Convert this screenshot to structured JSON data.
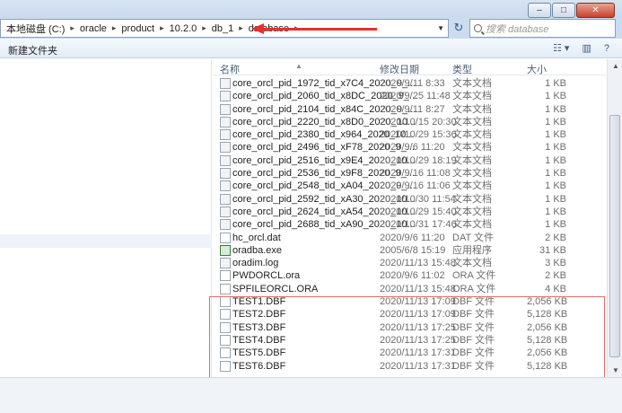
{
  "window": {
    "min_label": "–",
    "max_label": "□",
    "close_label": "✕"
  },
  "address": {
    "crumbs": [
      "本地磁盘 (C:)",
      "oracle",
      "product",
      "10.2.0",
      "db_1",
      "database"
    ],
    "separator": "▸"
  },
  "search": {
    "placeholder": "搜索 database"
  },
  "toolbar": {
    "new_folder_label": "新建文件夹"
  },
  "columns": {
    "name": "名称",
    "date": "修改日期",
    "type": "类型",
    "size": "大小"
  },
  "files": [
    {
      "name": "core_orcl_pid_1972_tid_x7C4_2020_9_...",
      "date": "2020/9/11 8:33",
      "type": "文本文档",
      "size": "1 KB",
      "icon": "text-file"
    },
    {
      "name": "core_orcl_pid_2060_tid_x8DC_2020_9_...",
      "date": "2020/9/25 11:48",
      "type": "文本文档",
      "size": "1 KB",
      "icon": "text-file"
    },
    {
      "name": "core_orcl_pid_2104_tid_x84C_2020_9_...",
      "date": "2020/9/11 8:27",
      "type": "文本文档",
      "size": "1 KB",
      "icon": "text-file"
    },
    {
      "name": "core_orcl_pid_2220_tid_x8D0_2020_10...",
      "date": "2020/10/15 20:30",
      "type": "文本文档",
      "size": "1 KB",
      "icon": "text-file"
    },
    {
      "name": "core_orcl_pid_2380_tid_x964_2020_10...",
      "date": "2020/10/29 15:36",
      "type": "文本文档",
      "size": "1 KB",
      "icon": "text-file"
    },
    {
      "name": "core_orcl_pid_2496_tid_xF78_2020_9_...",
      "date": "2020/9/6 11:20",
      "type": "文本文档",
      "size": "1 KB",
      "icon": "text-file"
    },
    {
      "name": "core_orcl_pid_2516_tid_x9E4_2020_10...",
      "date": "2020/10/29 18:19",
      "type": "文本文档",
      "size": "1 KB",
      "icon": "text-file"
    },
    {
      "name": "core_orcl_pid_2536_tid_x9F8_2020_9_...",
      "date": "2020/9/16 11:08",
      "type": "文本文档",
      "size": "1 KB",
      "icon": "text-file"
    },
    {
      "name": "core_orcl_pid_2548_tid_xA04_2020_9_...",
      "date": "2020/9/16 11:06",
      "type": "文本文档",
      "size": "1 KB",
      "icon": "text-file"
    },
    {
      "name": "core_orcl_pid_2592_tid_xA30_2020_10...",
      "date": "2020/10/30 11:54",
      "type": "文本文档",
      "size": "1 KB",
      "icon": "text-file"
    },
    {
      "name": "core_orcl_pid_2624_tid_xA54_2020_10...",
      "date": "2020/10/29 15:40",
      "type": "文本文档",
      "size": "1 KB",
      "icon": "text-file"
    },
    {
      "name": "core_orcl_pid_2688_tid_xA90_2020_10...",
      "date": "2020/10/31 17:46",
      "type": "文本文档",
      "size": "1 KB",
      "icon": "text-file"
    },
    {
      "name": "hc_orcl.dat",
      "date": "2020/9/6 11:20",
      "type": "DAT 文件",
      "size": "2 KB",
      "icon": "file"
    },
    {
      "name": "oradba.exe",
      "date": "2005/6/8 15:19",
      "type": "应用程序",
      "size": "31 KB",
      "icon": "exe"
    },
    {
      "name": "oradim.log",
      "date": "2020/11/13 15:48",
      "type": "文本文档",
      "size": "3 KB",
      "icon": "text-file"
    },
    {
      "name": "PWDORCL.ora",
      "date": "2020/9/6 11:02",
      "type": "ORA 文件",
      "size": "2 KB",
      "icon": "file"
    },
    {
      "name": "SPFILEORCL.ORA",
      "date": "2020/11/13 15:48",
      "type": "ORA 文件",
      "size": "4 KB",
      "icon": "file"
    },
    {
      "name": "TEST1.DBF",
      "date": "2020/11/13 17:09",
      "type": "DBF 文件",
      "size": "2,056 KB",
      "icon": "file"
    },
    {
      "name": "TEST2.DBF",
      "date": "2020/11/13 17:09",
      "type": "DBF 文件",
      "size": "5,128 KB",
      "icon": "file"
    },
    {
      "name": "TEST3.DBF",
      "date": "2020/11/13 17:25",
      "type": "DBF 文件",
      "size": "2,056 KB",
      "icon": "file"
    },
    {
      "name": "TEST4.DBF",
      "date": "2020/11/13 17:25",
      "type": "DBF 文件",
      "size": "5,128 KB",
      "icon": "file"
    },
    {
      "name": "TEST5.DBF",
      "date": "2020/11/13 17:31",
      "type": "DBF 文件",
      "size": "2,056 KB",
      "icon": "file"
    },
    {
      "name": "TEST6.DBF",
      "date": "2020/11/13 17:31",
      "type": "DBF 文件",
      "size": "5,128 KB",
      "icon": "file"
    }
  ],
  "colors": {
    "annotation_red": "#e4322b",
    "highlight_box": "#e46a66"
  }
}
